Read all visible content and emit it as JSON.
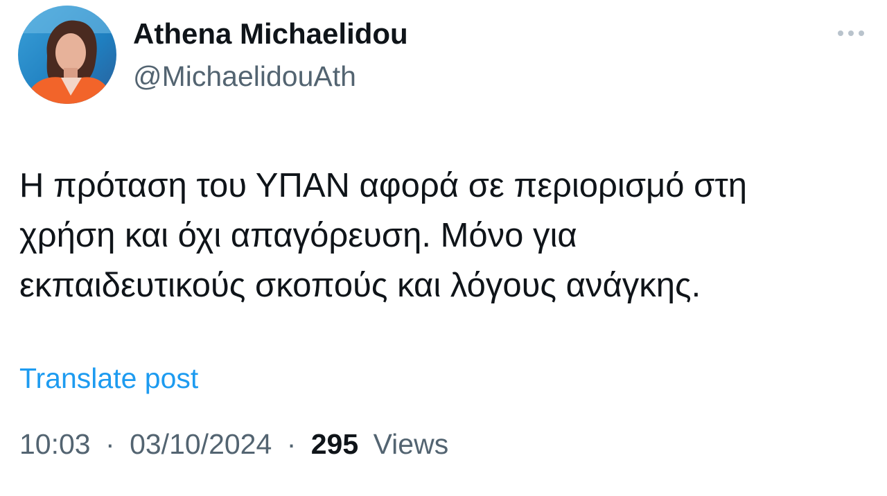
{
  "author": {
    "name": "Athena Michaelidou",
    "handle": "@MichaelidouAth"
  },
  "post": {
    "lines": [
      "Η πρόταση του ΥΠΑΝ αφορά σε περιορισμό στη",
      "χρήση και όχι απαγόρευση. Μόνο για",
      "εκπαιδευτικούς σκοπούς και λόγους ανάγκης."
    ],
    "translate_label": "Translate post"
  },
  "meta": {
    "time": "10:03",
    "separator": "·",
    "date": "03/10/2024",
    "views_count": "295",
    "views_label": "Views"
  },
  "icons": {
    "more": "more-horizontal-icon"
  },
  "colors": {
    "text_primary": "#0f1419",
    "text_secondary": "#536471",
    "link": "#1d9bf0"
  }
}
